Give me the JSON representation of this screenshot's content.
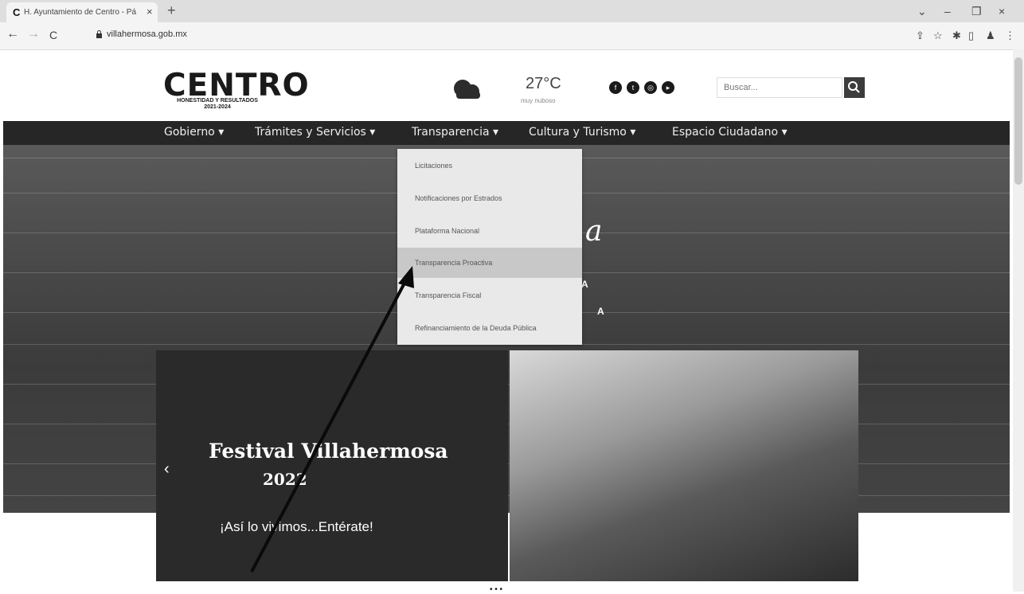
{
  "browser": {
    "tab_title": "H. Ayuntamiento de Centro - Pá",
    "tab_favicon": "C",
    "tab_close": "×",
    "new_tab": "+",
    "url": "villahermosa.gob.mx",
    "window_controls": {
      "collapse": "⌄",
      "minimize": "–",
      "restore": "❐",
      "close": "×"
    },
    "nav": {
      "back": "←",
      "forward": "→",
      "reload": "C"
    },
    "toolbar_icons": [
      "share-icon",
      "star-icon",
      "extensions-icon",
      "sidebar-icon",
      "profile-icon",
      "menu-icon"
    ]
  },
  "header": {
    "logo_title": "CENTRO",
    "logo_subtitle": "HONESTIDAD Y RESULTADOS",
    "logo_years": "2021-2024",
    "weather_temp": "27°C",
    "weather_desc": "muy nuboso",
    "social_icons": [
      "facebook-icon",
      "twitter-icon",
      "instagram-icon",
      "youtube-icon"
    ],
    "search_placeholder": "Buscar..."
  },
  "nav": {
    "items": [
      {
        "label": "Gobierno ▾"
      },
      {
        "label": "Trámites y Servicios ▾"
      },
      {
        "label": "Transparencia ▾"
      },
      {
        "label": "Cultura y Turismo ▾"
      },
      {
        "label": "Espacio Ciudadano ▾"
      }
    ]
  },
  "dropdown": {
    "items": [
      {
        "label": "Licitaciones"
      },
      {
        "label": "Notificaciones por Estrados"
      },
      {
        "label": "Plataforma Nacional"
      },
      {
        "label": "Transparencia Proactiva"
      },
      {
        "label": "Transparencia Fiscal"
      },
      {
        "label": "Refinanciamiento de la Deuda Pública"
      }
    ]
  },
  "hero": {
    "script_text": "a",
    "letter_a1": "A",
    "letter_a2": "A",
    "festival": "Festival Villahermosa",
    "year": "2022",
    "subtitle": "¡Así lo vivimos...Entérate!",
    "prev": "‹"
  },
  "bottom": {
    "indicator": "• • •"
  },
  "colors": {
    "nav_bg": "#262626",
    "dropdown_bg": "#e9e9e9",
    "dropdown_active": "#c8c8c8",
    "search_button": "#3c3c3c"
  }
}
